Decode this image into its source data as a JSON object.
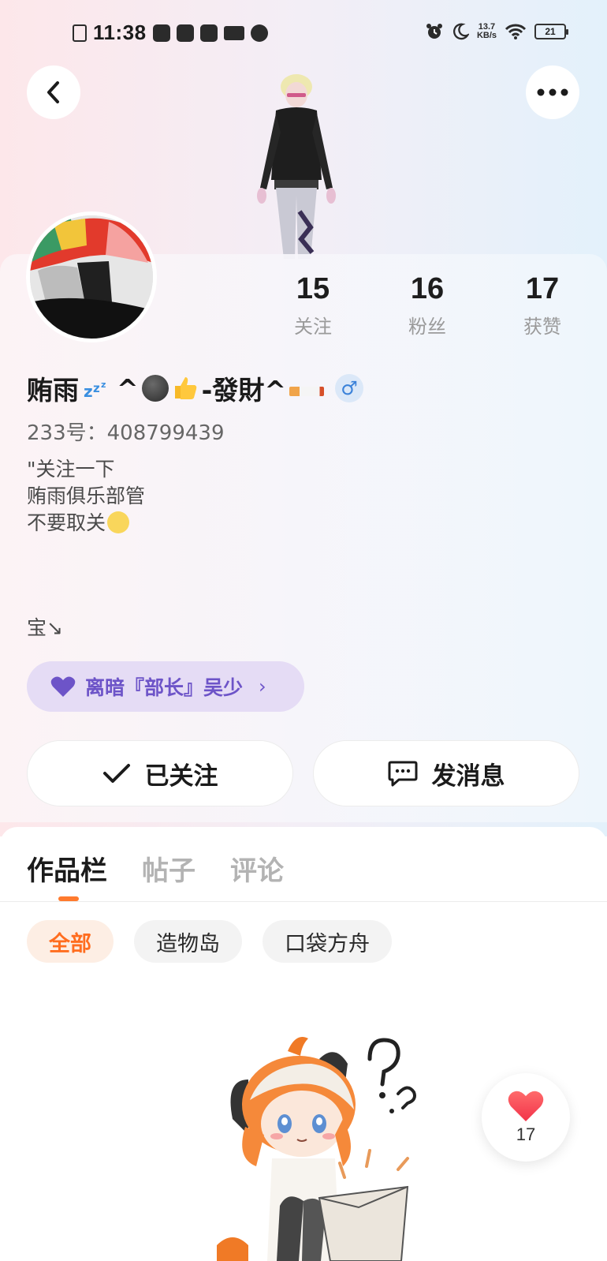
{
  "status_bar": {
    "time": "11:38",
    "net_speed_value": "13.7",
    "net_speed_unit": "KB/s",
    "battery": "21"
  },
  "profile": {
    "stats": [
      {
        "value": "15",
        "label": "关注"
      },
      {
        "value": "16",
        "label": "粉丝"
      },
      {
        "value": "17",
        "label": "获赞"
      }
    ],
    "name_part1": "贿雨",
    "name_part2": "^",
    "name_part3": "-發財^",
    "gender_symbol": "♂",
    "uid": "233号：408799439",
    "bio_lines": [
      "\"关注一下",
      "贿雨俱乐部管",
      "不要取关"
    ],
    "bao": "宝↘",
    "club": {
      "label": "离暗『部长』吴少",
      "chevron": "›"
    },
    "follow_label": "已关注",
    "message_label": "发消息"
  },
  "tabs": [
    {
      "label": "作品栏",
      "active": true
    },
    {
      "label": "帖子",
      "active": false
    },
    {
      "label": "评论",
      "active": false
    }
  ],
  "filters": [
    {
      "label": "全部",
      "active": true
    },
    {
      "label": "造物岛",
      "active": false
    },
    {
      "label": "口袋方舟",
      "active": false
    }
  ],
  "like_float": {
    "count": "17"
  },
  "colors": {
    "accent": "#ff7a2e",
    "club": "#6d54c8",
    "gender": "#3b82d9"
  },
  "icons": [
    "back-arrow-icon",
    "more-dots-icon",
    "heart-icon",
    "checkmark-icon",
    "chat-bubble-icon",
    "male-icon"
  ]
}
